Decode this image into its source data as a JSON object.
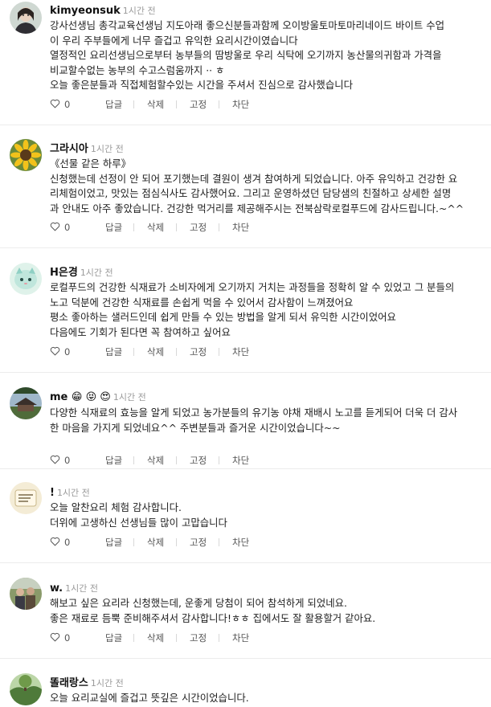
{
  "actions": {
    "reply": "답글",
    "delete": "삭제",
    "pin": "고정",
    "block": "차단"
  },
  "comments": [
    {
      "username": "kimyeonsuk",
      "emoji": "",
      "time": "1시간 전",
      "likes": "0",
      "lines": [
        "강사선생님  총각교육선생님 지도아래 좋으신분들과함께  오이방울토마토마리네이드 바이트 수업",
        "이  우리 주부들에게 너무 즐겁고  유익한 요리시간이였습니다",
        "열정적인 요리선생님으로부터 농부들의 땀방울로 우리 식탁에 오기까지  농산물의귀함과  가격을",
        "비교할수없는 농부의 수고스럼움까지 ·· ㅎ",
        "오늘 좋은분들과  직접체험할수있는 시간을 주셔서 진심으로  감사했습니다"
      ]
    },
    {
      "username": "그라시아",
      "emoji": "",
      "time": "1시간 전",
      "likes": "0",
      "lines": [
        "《선물 같은 하루》",
        "신청했는데 선정이 안 되어 포기했는데 결원이 생겨 참여하게 되었습니다. 아주 유익하고 건강한 요",
        "리체험이었고, 맛있는 점심식사도 감사했어요. 그리고 운영하셨던 담당샘의 친절하고 상세한 설명",
        "과 안내도 아주 좋았습니다. 건강한 먹거리를 제공해주시는 전북삼락로컬푸드에 감사드립니다.~^^"
      ]
    },
    {
      "username": "H은경",
      "emoji": "",
      "time": "1시간 전",
      "likes": "0",
      "lines": [
        "로컬푸드의 건강한 식재료가 소비자에게 오기까지 거치는 과정들을 정확히 알 수 있었고 그 분들의",
        "노고 덕분에 건강한 식재료를 손쉽게 먹을 수 있어서 감사함이 느껴졌어요",
        "평소 좋아하는 샐러드인데 쉽게 만들 수 있는 방법을 알게 되서 유익한 시간이었어요",
        "다음에도 기회가 된다면 꼭 참여하고 싶어요"
      ]
    },
    {
      "username": "me",
      "emoji": "😁 😝 😍",
      "time": "1시간 전",
      "likes": "0",
      "lines": [
        "다양한 식재료의 효능을 알게 되었고 농가분들의 유기농 야채 재배시 노고를 듣게되어 더욱 더 감사",
        "한 마음을 가지게 되었네요^^ 주변분들과 즐거운 시간이었습니다~~"
      ]
    },
    {
      "username": "!",
      "emoji": "",
      "time": "1시간 전",
      "likes": "0",
      "lines": [
        "오늘 알찬요리 체험 감사합니다.",
        "더위에 고생하신 선생님들 많이 고맙습니다"
      ]
    },
    {
      "username": "w.",
      "emoji": "",
      "time": "1시간 전",
      "likes": "0",
      "lines": [
        "해보고 싶은 요리라 신청했는데, 운좋게 당첨이 되어 참석하게 되었네요.",
        "좋은 재료로 듬뿍 준비해주셔서 감사합니다!ㅎㅎ 집에서도 잘 활용할거 같아요."
      ]
    },
    {
      "username": "똘래랑스",
      "emoji": "",
      "time": "1시간 전",
      "likes": "",
      "lines": [
        "오늘 요리교실에 즐겁고 뜻깊은 시간이었습니다."
      ]
    }
  ]
}
